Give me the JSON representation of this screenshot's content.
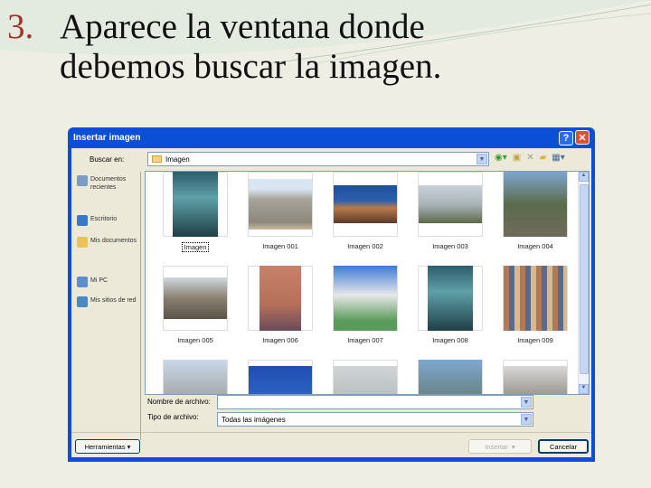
{
  "slide": {
    "number": "3.",
    "line1": "Aparece la ventana donde",
    "line2": "debemos buscar la imagen."
  },
  "dialog": {
    "title": "Insertar imagen",
    "help": "?",
    "close": "✕",
    "look_in_label": "Buscar en:",
    "look_in_value": "Imagen",
    "places": [
      {
        "label": "Documentos recientes",
        "color": "#7a9cc6"
      },
      {
        "label": "Escritorio",
        "color": "#3a78c8"
      },
      {
        "label": "Mis documentos",
        "color": "#e8c25a"
      },
      {
        "label": "Mi PC",
        "color": "#5a8fd0"
      },
      {
        "label": "Mis sitios de red",
        "color": "#4a8ac0"
      }
    ],
    "files": [
      {
        "name": "Imagen",
        "bg": "linear-gradient(#2c5d6e,#5fa0a8 40%,#1f3f46)",
        "h": 72,
        "w": 50
      },
      {
        "name": "Imagen 001",
        "bg": "linear-gradient(#d9e6f2 20%,#a8a49a 40%,#8d887c 85%,#c8b89a)",
        "h": 56
      },
      {
        "name": "Imagen 002",
        "bg": "linear-gradient(#1f4f9a,#2a5fae 40%,#b87a4a 60%,#5a3a2a)",
        "h": 42
      },
      {
        "name": "Imagen 003",
        "bg": "linear-gradient(#c9d2da,#a9b4b8 50%,#5c6a4a)",
        "h": 42
      },
      {
        "name": "Imagen 004",
        "bg": "linear-gradient(#7ea6d0,#5b6b4a 50%,#6f6a5a)",
        "h": 72
      },
      {
        "name": "Imagen 005",
        "bg": "linear-gradient(#cfd8e0,#8a8070 50%,#5a5448)",
        "h": 46
      },
      {
        "name": "Imagen 006",
        "bg": "linear-gradient(#c8826a,#b5705a 60%,#6a4a5a)",
        "h": 72,
        "w": 46
      },
      {
        "name": "Imagen 007",
        "bg": "linear-gradient(#3a7ad8,#e8e8e8 45%,#5a9a5a 85%)",
        "h": 72
      },
      {
        "name": "Imagen 008",
        "bg": "linear-gradient(#2c5d6e,#5fa0a8 40%,#1f3f46)",
        "h": 72,
        "w": 50
      },
      {
        "name": "Imagen 009",
        "bg": "repeating-linear-gradient(90deg,#b07a5a 0 6px,#5a6a8a 6px 12px,#d8b890 12px 18px)",
        "h": 72
      },
      {
        "name": "",
        "bg": "linear-gradient(#c9d8ea,#8a8678)",
        "h": 72
      },
      {
        "name": "",
        "bg": "linear-gradient(#1f4fb0,#2a5fc0 50%,#b8865a)",
        "h": 58
      },
      {
        "name": "",
        "bg": "linear-gradient(#d0d4d6,#a8b2b0)",
        "h": 58
      },
      {
        "name": "",
        "bg": "linear-gradient(#7ea6d0,#5b6b4a)",
        "h": 72
      },
      {
        "name": "",
        "bg": "linear-gradient(#d8d8d8,#6a6458)",
        "h": 58
      }
    ],
    "filename_label": "Nombre de archivo:",
    "filename_value": "",
    "filetype_label": "Tipo de archivo:",
    "filetype_value": "Todas las imágenes",
    "tools_button": "Herramientas",
    "insert_button": "Insertar",
    "cancel_button": "Cancelar"
  }
}
